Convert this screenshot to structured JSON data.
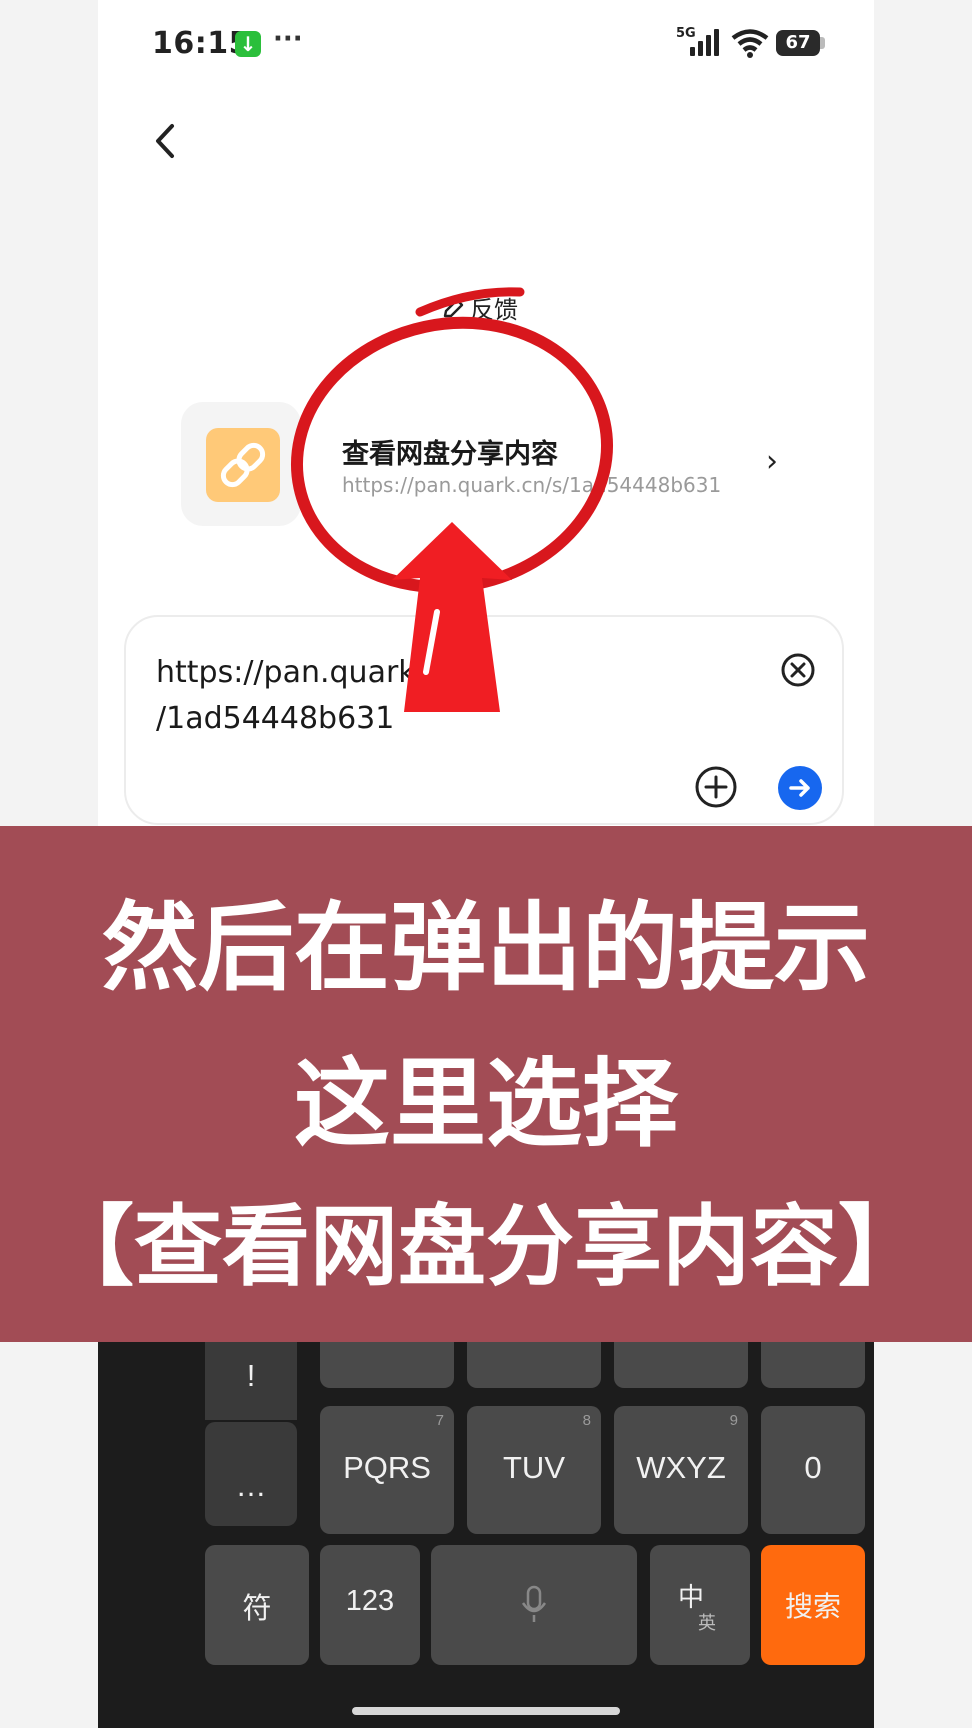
{
  "status_bar": {
    "time": "16:15",
    "more": "···",
    "network": "5G",
    "battery": "67"
  },
  "header": {
    "feedback_label": "反馈"
  },
  "suggestion": {
    "title": "查看网盘分享内容",
    "url": "https://pan.quark.cn/s/1ad54448b631"
  },
  "input": {
    "line1": "https://pan.quark.cn/s",
    "line2": "/1ad54448b631"
  },
  "keyboard": {
    "row1": [
      {
        "label": "!"
      }
    ],
    "row2": [
      {
        "label": "…"
      },
      {
        "label": "PQRS",
        "num": "7"
      },
      {
        "label": "TUV",
        "num": "8"
      },
      {
        "label": "WXYZ",
        "num": "9"
      },
      {
        "label": "0"
      }
    ],
    "row3": {
      "symbol": "符",
      "num_switch": "123",
      "lang_main": "中",
      "lang_alt": "英",
      "search": "搜索"
    }
  },
  "caption": {
    "line1": "然后在弹出的提示",
    "line2": "这里选择",
    "line3": "【查看网盘分享内容】"
  },
  "colors": {
    "banner_bg": "#a24c55",
    "accent_blue": "#1767ef",
    "search_key": "#ff6a0e",
    "annotation_red": "#d8171d"
  }
}
